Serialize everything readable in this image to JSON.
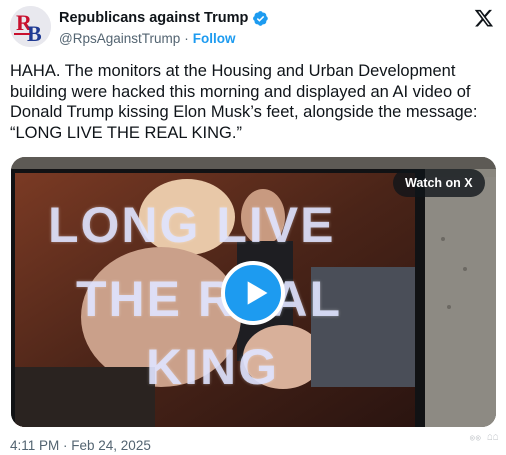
{
  "author": {
    "display_name": "Republicans against Trump",
    "handle": "@RpsAgainstTrump",
    "separator": "·",
    "follow_label": "Follow",
    "avatar_letters": "RB"
  },
  "tweet": {
    "text": "HAHA. The monitors at the Housing and Urban Development building were hacked this morning and displayed an AI video of Donald Trump kissing Elon Musk’s feet, alongside the message: “LONG LIVE THE REAL KING.”",
    "timestamp": "4:11 PM · Feb 24, 2025"
  },
  "media": {
    "watch_label": "Watch on X",
    "overlay_lines": [
      "LONG LIVE",
      "THE REAL",
      "KING"
    ]
  },
  "colors": {
    "accent": "#1d9bf0",
    "text_primary": "#0f1419",
    "text_secondary": "#536471"
  },
  "icons": {
    "verified": "verified-badge-icon",
    "platform": "x-logo-icon",
    "play": "play-icon"
  }
}
